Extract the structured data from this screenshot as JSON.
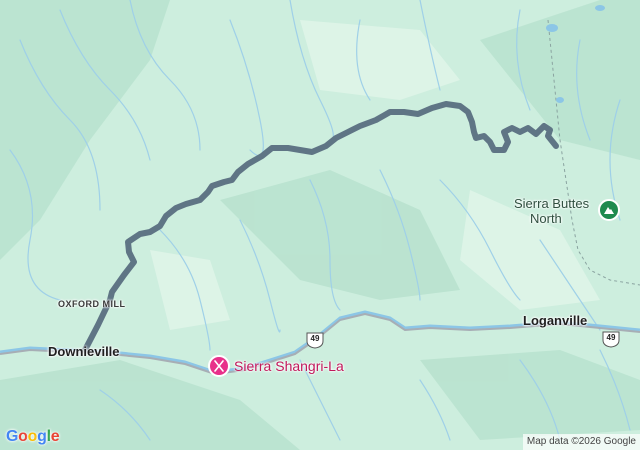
{
  "map": {
    "places": {
      "downieville": "Downieville",
      "loganville": "Loganville",
      "oxford_mill": "OXFORD MILL"
    },
    "poi": {
      "name": "Sierra Shangri-La",
      "icon": "fork-knife-icon",
      "color": "#e8308a"
    },
    "peak": {
      "line1": "Sierra Buttes",
      "line2": "North",
      "icon": "mountain-icon",
      "color": "#1e8a4e"
    },
    "highway_shields": [
      "49",
      "49"
    ],
    "route_color": "#5f7585",
    "terrain_color": "#cdeede",
    "water_color": "#8cc6e6"
  },
  "branding": {
    "logo": "Google",
    "logo_colors": [
      "#4285F4",
      "#EA4335",
      "#FBBC05",
      "#4285F4",
      "#34A853",
      "#EA4335"
    ],
    "attribution": "Map data ©2026 Google"
  }
}
